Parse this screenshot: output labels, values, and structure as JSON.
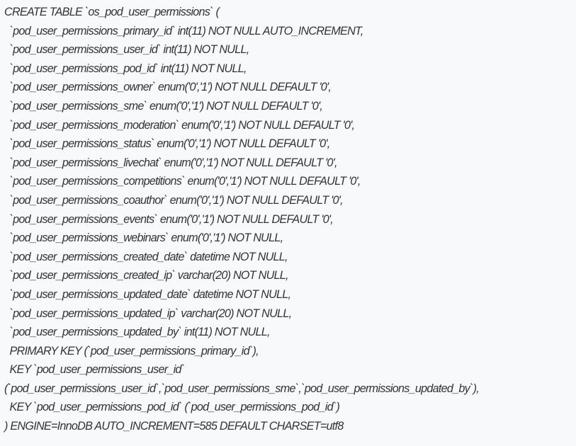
{
  "code": {
    "lines": [
      "CREATE TABLE `os_pod_user_permissions` (",
      "  `pod_user_permissions_primary_id` int(11) NOT NULL AUTO_INCREMENT,",
      "  `pod_user_permissions_user_id` int(11) NOT NULL,",
      "  `pod_user_permissions_pod_id` int(11) NOT NULL,",
      "  `pod_user_permissions_owner` enum('0','1') NOT NULL DEFAULT '0',",
      "  `pod_user_permissions_sme` enum('0','1') NOT NULL DEFAULT '0',",
      "  `pod_user_permissions_moderation` enum('0','1') NOT NULL DEFAULT '0',",
      "  `pod_user_permissions_status` enum('0','1') NOT NULL DEFAULT '0',",
      "  `pod_user_permissions_livechat` enum('0','1') NOT NULL DEFAULT '0',",
      "  `pod_user_permissions_competitions` enum('0','1') NOT NULL DEFAULT '0',",
      "  `pod_user_permissions_coauthor` enum('0','1') NOT NULL DEFAULT '0',",
      "  `pod_user_permissions_events` enum('0','1') NOT NULL DEFAULT '0',",
      "  `pod_user_permissions_webinars` enum('0','1') NOT NULL,",
      "  `pod_user_permissions_created_date` datetime NOT NULL,",
      "  `pod_user_permissions_created_ip` varchar(20) NOT NULL,",
      "  `pod_user_permissions_updated_date` datetime NOT NULL,",
      "  `pod_user_permissions_updated_ip` varchar(20) NOT NULL,",
      "  `pod_user_permissions_updated_by` int(11) NOT NULL,",
      "  PRIMARY KEY (`pod_user_permissions_primary_id`),",
      "  KEY `pod_user_permissions_user_id`",
      "(`pod_user_permissions_user_id`,`pod_user_permissions_sme`,`pod_user_permissions_updated_by`),",
      "  KEY `pod_user_permissions_pod_id` (`pod_user_permissions_pod_id`)",
      ") ENGINE=InnoDB AUTO_INCREMENT=585 DEFAULT CHARSET=utf8"
    ]
  }
}
